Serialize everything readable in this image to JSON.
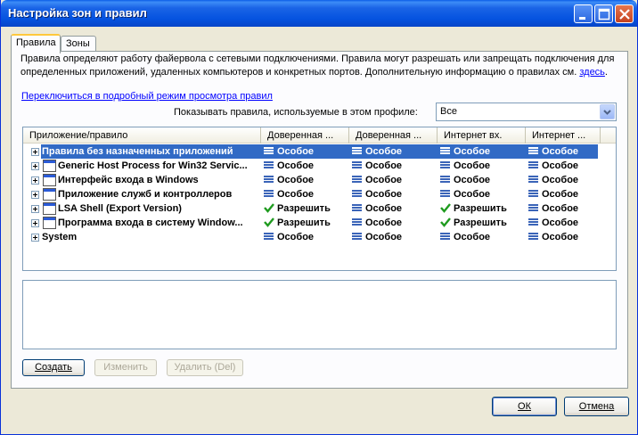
{
  "window": {
    "title": "Настройка зон и правил"
  },
  "tabs": [
    {
      "label": "Правила"
    },
    {
      "label": "Зоны"
    }
  ],
  "description": {
    "text": "Правила определяют работу файервола с сетевыми подключениями. Правила могут разрешать или запрещать подключения для определенных приложений, удаленных компьютеров и конкретных портов. Дополнительную информацию о правилах см. ",
    "link": "здесь",
    "end": "."
  },
  "detailed_link": "Переключиться в подробный режим просмотра правил",
  "profile": {
    "label": "Показывать правила, используемые в этом профиле:",
    "value": "Все"
  },
  "columns": [
    "Приложение/правило",
    "Доверенная ...",
    "Доверенная ...",
    "Интернет вх.",
    "Интернет ..."
  ],
  "rules": [
    {
      "name": "Правила без назначенных приложений",
      "icon": "none",
      "values": [
        "Особое",
        "Особое",
        "Особое",
        "Особое"
      ],
      "selected": true
    },
    {
      "name": "Generic Host Process for Win32 Servic...",
      "icon": "app-window-icon",
      "values": [
        "Особое",
        "Особое",
        "Особое",
        "Особое"
      ]
    },
    {
      "name": "Интерфейс входа в Windows",
      "icon": "app-window-icon",
      "values": [
        "Особое",
        "Особое",
        "Особое",
        "Особое"
      ]
    },
    {
      "name": "Приложение служб и контроллеров",
      "icon": "app-window-icon",
      "values": [
        "Особое",
        "Особое",
        "Особое",
        "Особое"
      ]
    },
    {
      "name": "LSA Shell (Export Version)",
      "icon": "app-window-icon",
      "values": [
        "Разрешить",
        "Особое",
        "Разрешить",
        "Особое"
      ]
    },
    {
      "name": "Программа входа в систему Window...",
      "icon": "logon-app-icon",
      "values": [
        "Разрешить",
        "Особое",
        "Разрешить",
        "Особое"
      ]
    },
    {
      "name": "System",
      "icon": "none",
      "values": [
        "Особое",
        "Особое",
        "Особое",
        "Особое"
      ]
    }
  ],
  "buttons": {
    "create": "Создать",
    "edit": "Изменить",
    "delete": "Удалить (Del)",
    "ok": "ОК",
    "cancel": "Отмена"
  }
}
